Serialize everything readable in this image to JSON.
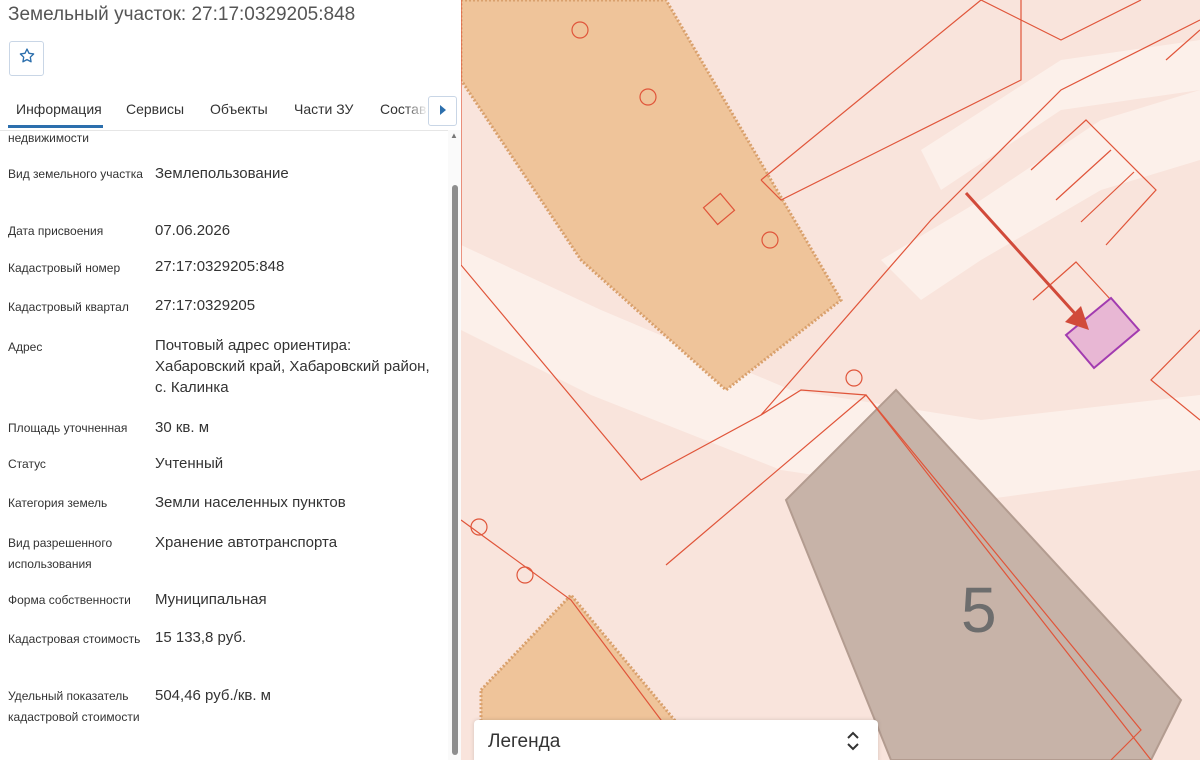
{
  "header": {
    "title": "Земельный участок: 27:17:0329205:848"
  },
  "tabs": [
    {
      "label": "Информация",
      "active": true
    },
    {
      "label": "Сервисы"
    },
    {
      "label": "Объекты"
    },
    {
      "label": "Части ЗУ"
    },
    {
      "label": "Состав"
    }
  ],
  "rows": [
    {
      "label": "недвижимости",
      "value": ""
    },
    {
      "label": "Вид земельного участка",
      "value": "Землепользование"
    },
    {
      "label": "Дата присвоения",
      "value": "07.06.2026"
    },
    {
      "label": "Кадастровый номер",
      "value": "27:17:0329205:848"
    },
    {
      "label": "Кадастровый квартал",
      "value": "27:17:0329205"
    },
    {
      "label": "Адрес",
      "value": "Почтовый адрес ориентира: Хабаровский край, Хабаровский район, с. Калинка"
    },
    {
      "label": "Площадь уточненная",
      "value": "30 кв. м"
    },
    {
      "label": "Статус",
      "value": "Учтенный"
    },
    {
      "label": "Категория земель",
      "value": "Земли населенных пунктов"
    },
    {
      "label": "Вид разрешенного использования",
      "value": "Хранение автотранспорта"
    },
    {
      "label": "Форма собственности",
      "value": "Муниципальная"
    },
    {
      "label": "Кадастровая стоимость",
      "value": "15 133,8 руб."
    },
    {
      "label": "Удельный показатель кадастровой стоимости",
      "value": "504,46 руб./кв. м"
    }
  ],
  "map": {
    "building_number": "5",
    "legend_title": "Легенда",
    "colors": {
      "background": "#f9e4dc",
      "road": "#fcf0ea",
      "parcel_line": "#e0553a",
      "building_orange": "#efc49a",
      "building_gray": "#c7b3a8",
      "selected_fill": "#e8b7d4",
      "selected_stroke": "#a23bb0",
      "arrow": "#d14a3a"
    }
  },
  "icons": {
    "favorite": "star-outline-icon",
    "tabs_next": "caret-right-icon",
    "legend_toggle": "chevron-up-down-icon"
  }
}
